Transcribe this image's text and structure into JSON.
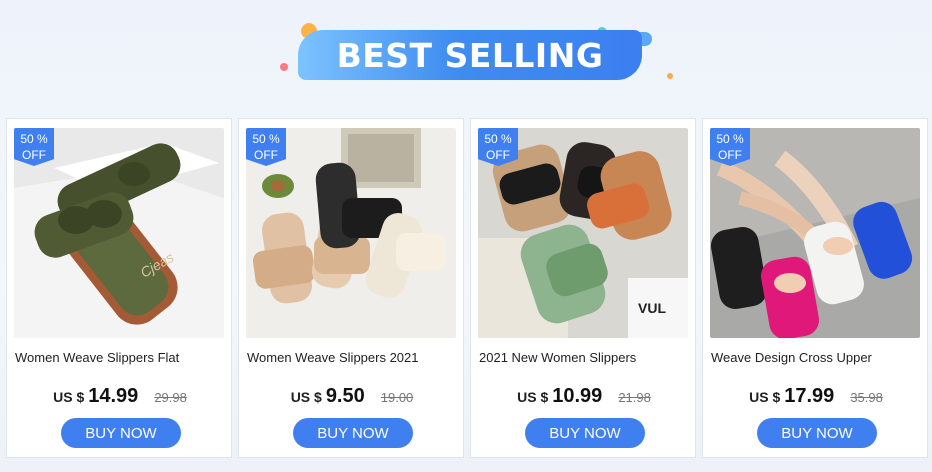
{
  "header": {
    "title": "BEST SELLING"
  },
  "colors": {
    "accent": "#3f7ff0",
    "banner_light": "#7cc3ff"
  },
  "products": [
    {
      "badge_pct": "50 %",
      "badge_off": "OFF",
      "title": "Women Weave Slippers Flat",
      "currency": "US $",
      "price": "14.99",
      "old_price": "29.98",
      "buy_label": "BUY NOW"
    },
    {
      "badge_pct": "50 %",
      "badge_off": "OFF",
      "title": "Women Weave Slippers 2021",
      "currency": "US $",
      "price": "9.50",
      "old_price": "19.00",
      "buy_label": "BUY NOW"
    },
    {
      "badge_pct": "50 %",
      "badge_off": "OFF",
      "title": "2021 New Women Slippers",
      "currency": "US $",
      "price": "10.99",
      "old_price": "21.98",
      "buy_label": "BUY NOW"
    },
    {
      "badge_pct": "50 %",
      "badge_off": "OFF",
      "title": "Weave Design Cross Upper",
      "currency": "US $",
      "price": "17.99",
      "old_price": "35.98",
      "buy_label": "BUY NOW"
    }
  ]
}
